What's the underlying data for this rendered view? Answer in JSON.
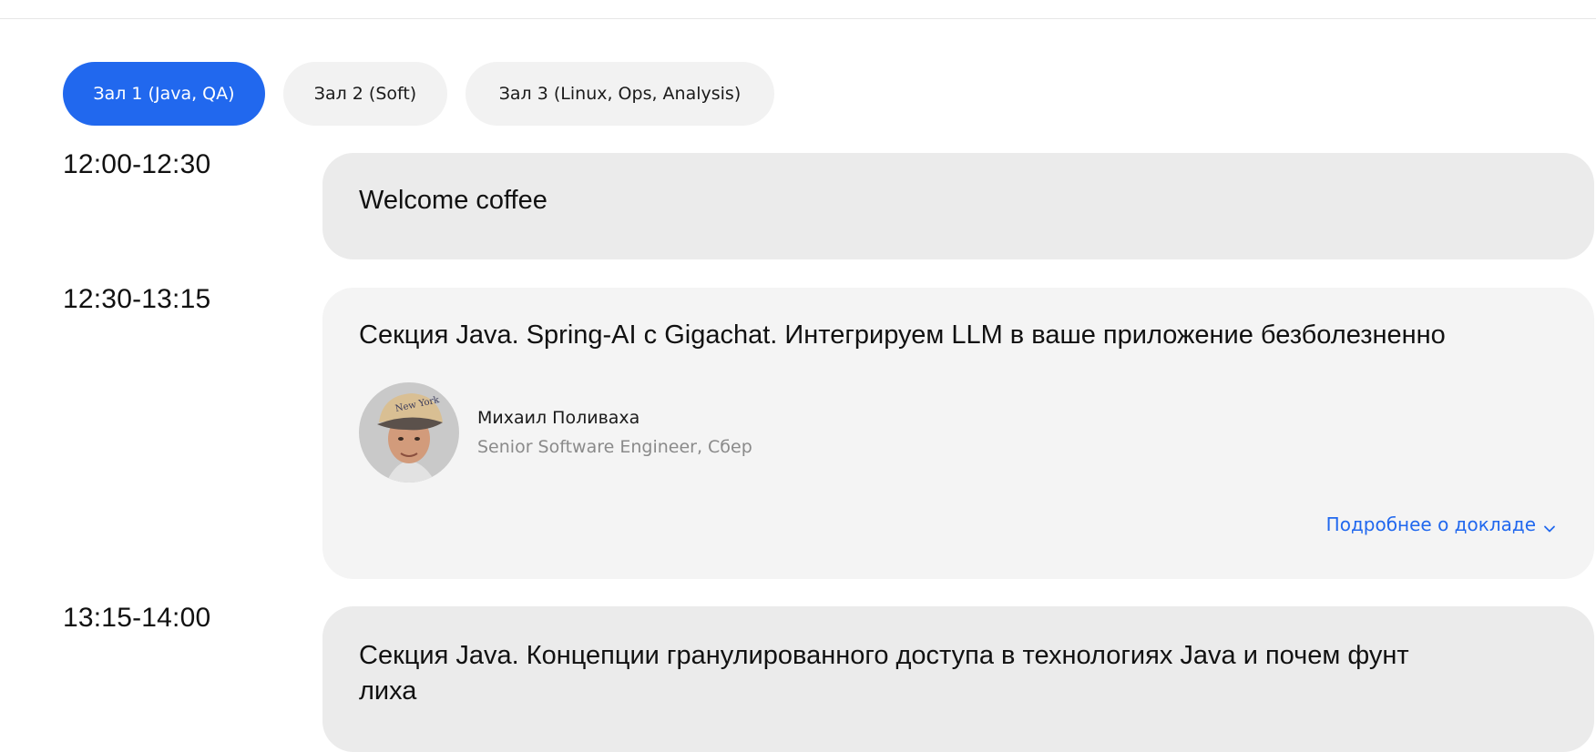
{
  "tabs": [
    {
      "label": "Зал 1 (Java, QA)",
      "active": true
    },
    {
      "label": "Зал 2 (Soft)",
      "active": false
    },
    {
      "label": "Зал 3 (Linux, Ops, Analysis)",
      "active": false
    }
  ],
  "schedule": [
    {
      "time": "12:00-12:30",
      "title": "Welcome coffee"
    },
    {
      "time": "12:30-13:15",
      "title": "Секция Java. Spring-AI с Gigachat. Интегрируем LLM в ваше приложение безболезненно",
      "speaker": {
        "name": "Михаил Поливаха",
        "role": "Senior Software Engineer, Сбер"
      },
      "more_link": "Подробнее о докладе"
    },
    {
      "time": "13:15-14:00",
      "title_line1": "Секция Java. Концепции гранулированного доступа в технологиях Java и почем фунт",
      "title_line2": "лиха"
    }
  ],
  "colors": {
    "accent": "#2168ee",
    "tab_bg": "#f2f2f2",
    "card_bg_plain": "#ebebeb",
    "card_bg_talk": "#f4f4f4",
    "muted_text": "#8a8a8a"
  },
  "icons": {
    "more_chevron": "chevron-down-icon"
  }
}
